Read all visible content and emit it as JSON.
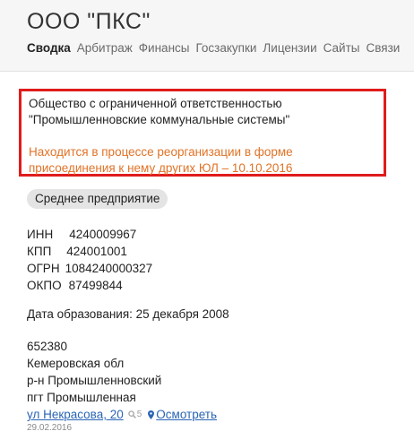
{
  "header": {
    "title": "ООО \"ПКС\"",
    "tabs": [
      "Сводка",
      "Арбитраж",
      "Финансы",
      "Госзакупки",
      "Лицензии",
      "Сайты",
      "Связи"
    ],
    "active_tab": "Сводка"
  },
  "company": {
    "full_name": "Общество с ограниченной ответственностью \"Промышленновские коммунальные системы\"",
    "reorganization_note": "Находится в процессе реорганизации в форме присоединения к нему других ЮЛ – 10.10.2016",
    "size_badge": "Среднее предприятие"
  },
  "identifiers": [
    {
      "label": "ИНН",
      "value": "4240009967"
    },
    {
      "label": "КПП",
      "value": "424001001"
    },
    {
      "label": "ОГРН",
      "value": "1084240000327"
    },
    {
      "label": "ОКПО",
      "value": "87499844"
    }
  ],
  "founded": "Дата образования: 25 декабря 2008",
  "address": {
    "postcode": "652380",
    "region": "Кемеровская обл",
    "district": "р-н Промышленновский",
    "settlement": "пгт Промышленная",
    "street": "ул Некрасова, 20",
    "search_count": "5",
    "view_label": "Осмотреть",
    "date": "29.02.2016"
  },
  "colors": {
    "highlight_border": "#e01c1c",
    "note_orange": "#e07327",
    "link_blue": "#2a64b5"
  }
}
